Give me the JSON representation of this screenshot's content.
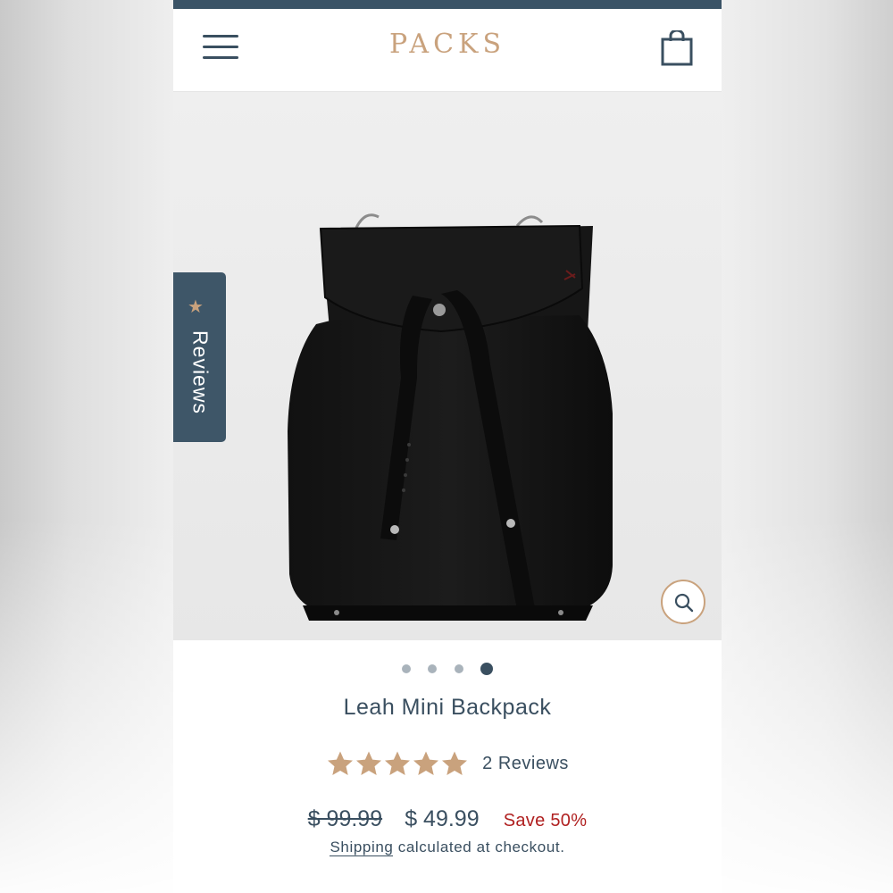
{
  "store": {
    "logo": "PACKS"
  },
  "reviews_tab": {
    "label": "Reviews"
  },
  "gallery": {
    "slide_count": 4,
    "active_slide": 4
  },
  "product": {
    "title": "Leah Mini Backpack",
    "rating": 5,
    "rating_max": 5,
    "review_count_label": "2 Reviews",
    "price_original": "$ 99.99",
    "price_sale": "$ 49.99",
    "save_label": "Save 50%",
    "shipping_link": "Shipping",
    "shipping_text": " calculated at checkout."
  },
  "colors": {
    "brand_navy": "#3a5366",
    "brand_gold": "#c9a27d",
    "sale_red": "#b02020"
  },
  "icons": {
    "menu": "hamburger-icon",
    "cart": "shopping-bag-icon",
    "zoom": "search-icon",
    "reviews": "star-icon"
  }
}
